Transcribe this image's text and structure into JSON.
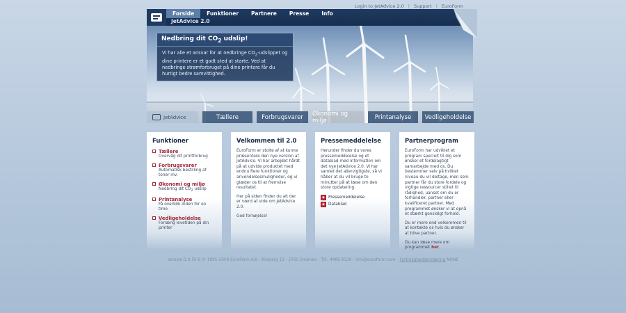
{
  "toplinks": {
    "login": "Login to JetAdvice 2.0",
    "sep": "|",
    "support": "Support",
    "euroform": "EuroForm"
  },
  "nav": {
    "items": [
      "Forside",
      "Funktioner",
      "Partnere",
      "Presse",
      "Info"
    ],
    "active": 0
  },
  "header": {
    "subtitle": "JetAdvice 2.0"
  },
  "promo": {
    "title_pre": "Nedbring dit CO",
    "title_sub": "2",
    "title_post": " udslip!",
    "text_pre": "Vi har alle et ansvar for at nedbringe CO",
    "text_sub": "2",
    "text_post": "-udslippet og dine printere er et godt sted at starte. Ved at nedbringe strømforbruget på dine printere får du hurtigt bedre samvittighed."
  },
  "tabs": [
    "JetAdvice",
    "Tællere",
    "Forbrugsvarer",
    "Økonomi og miljø",
    "Printanalyse",
    "Vedligeholdelse"
  ],
  "funktioner": {
    "title": "Funktioner",
    "items": [
      {
        "title": "Tællere",
        "desc": "Overvåg dit printforbrug"
      },
      {
        "title": "Forbrugsvarer",
        "desc": "Automatisk bestilling af toner mv."
      },
      {
        "title": "Økonomi og miljø",
        "desc_pre": "Nedbring dit CO",
        "desc_sub": "2",
        "desc_post": " udslip"
      },
      {
        "title": "Printanalyse",
        "desc": "Få overblik inden for en time"
      },
      {
        "title": "Vedligeholdelse",
        "desc": "Forlæng levetiden på din printer"
      }
    ]
  },
  "velkommen": {
    "title": "Velkommen til 2.0",
    "p1": "EuroForm er stolte af at kunne præsentere den nye version af JetAdvice. Vi har arbejdet hårdt på at udvide produktet med endnu flere funktioner og anvendelsesmuligheder, og vi glæder os til at fremvise resultatet.",
    "p2": "Her på siden finder du alt der er værd at vide om JetAdvice 2.0.",
    "p3": "God fornøjelse!"
  },
  "presse": {
    "title": "Pressemeddelelse",
    "p1": "Herunder finder du vores pressemeddelelse og et datablad med information om det nye JetAdvice 2.0. Vi har samlet det allervigtigste, så vi håber at du vil bruge to minutter på at læse om den store opdatering.",
    "files": [
      "Pressemeddelelse",
      "Datablad"
    ]
  },
  "partner": {
    "title": "Partnerprogram",
    "p1": "EuroForm har udviklet et program specielt til dig som ønsker et fordelagtigt samarbejde med os. Du bestemmer selv på hvilket niveau du vil deltage, men som partner får du store fordele og vigtige ressourcer stillet til rådighed, uanset om du er forhandler, partner eller kvalificeret partner. Med programmet ønsker vi at opnå et stærkt gensidigt forhold.",
    "p2": "Du er mere end velkommen til at kontakte os hvis du ønsker at blive partner.",
    "p3_pre": "Du kan læse mere om programmet ",
    "p3_link": "her",
    "p3_post": "."
  },
  "footer": {
    "text": "Version:1.0.50.6 © 1995-2009 EuroForm A/S - Risbjerg 13 - 2765 Smørum - Tlf.: 4466 9339 - info@euroform.com - ",
    "policy": "Fortrolighedserklæring",
    "suffix": " NONE"
  }
}
